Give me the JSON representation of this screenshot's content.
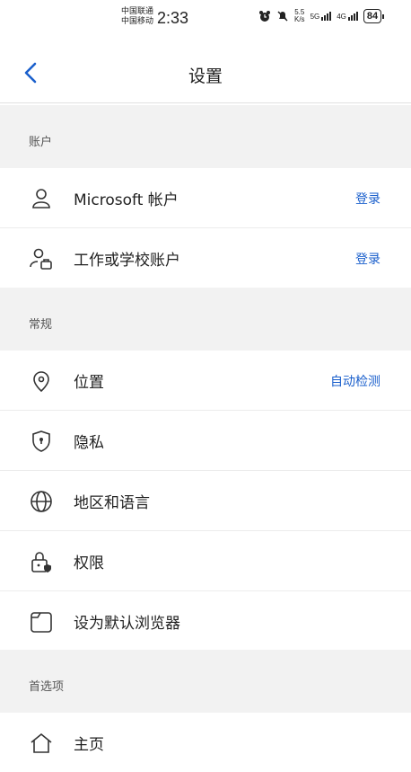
{
  "status": {
    "carrier1": "中国联通",
    "carrier2": "中国移动",
    "time": "2:33",
    "speed_value": "5.5",
    "speed_unit": "K/s",
    "net1": "5G",
    "net2": "4G",
    "battery": "84"
  },
  "header": {
    "title": "设置"
  },
  "sections": {
    "account": "账户",
    "general": "常规",
    "preferences": "首选项"
  },
  "account_rows": [
    {
      "label": "Microsoft 帐户",
      "action": "登录",
      "icon": "person-icon"
    },
    {
      "label": "工作或学校账户",
      "action": "登录",
      "icon": "work-account-icon"
    }
  ],
  "general_rows": [
    {
      "label": "位置",
      "action": "自动检测",
      "icon": "location-icon"
    },
    {
      "label": "隐私",
      "icon": "shield-icon"
    },
    {
      "label": "地区和语言",
      "icon": "globe-icon"
    },
    {
      "label": "权限",
      "icon": "lock-icon"
    },
    {
      "label": "设为默认浏览器",
      "icon": "browser-icon"
    }
  ],
  "preference_rows": [
    {
      "label": "主页",
      "icon": "home-icon"
    }
  ],
  "colors": {
    "accent": "#1a5fcc",
    "section_bg": "#f2f2f2",
    "divider": "#ececec"
  }
}
